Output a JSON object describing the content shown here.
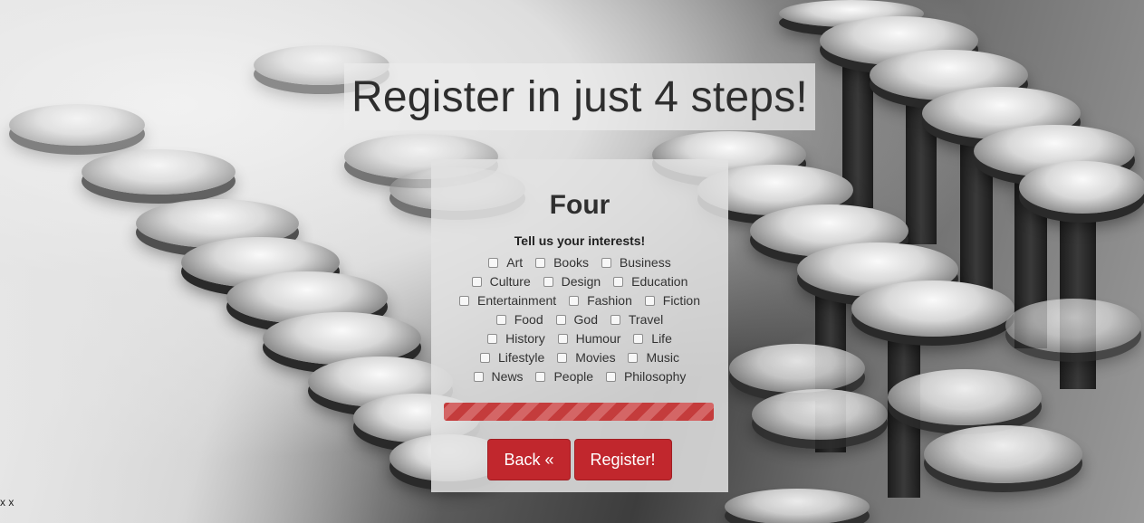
{
  "page": {
    "title": "Register in just 4 steps!",
    "corner_text": "x x"
  },
  "step": {
    "title": "Four",
    "prompt": "Tell us your interests!",
    "rows": [
      [
        "Art",
        "Books",
        "Business"
      ],
      [
        "Culture",
        "Design",
        "Education"
      ],
      [
        "Entertainment",
        "Fashion",
        "Fiction"
      ],
      [
        "Food",
        "God",
        "Travel"
      ],
      [
        "History",
        "Humour",
        "Life"
      ],
      [
        "Lifestyle",
        "Movies",
        "Music"
      ],
      [
        "News",
        "People",
        "Philosophy"
      ]
    ],
    "progress_fraction": 1.0
  },
  "buttons": {
    "back_label": "Back «",
    "register_label": "Register!"
  },
  "colors": {
    "accent": "#c1272d",
    "progress_stripe_dark": "#c43c3c",
    "progress_stripe_light": "#d46666"
  }
}
